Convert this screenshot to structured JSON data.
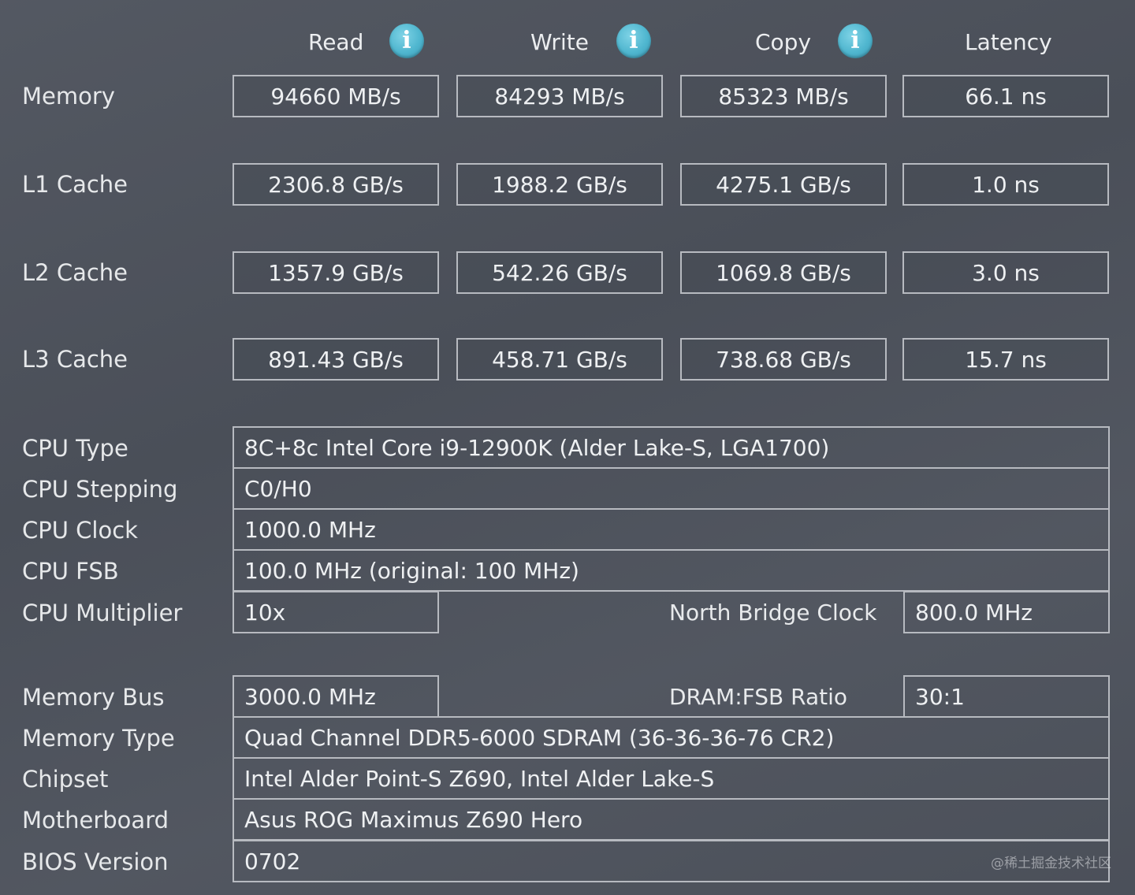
{
  "columns": {
    "read": "Read",
    "write": "Write",
    "copy": "Copy",
    "latency": "Latency",
    "info_icon_glyph": "i"
  },
  "bench": {
    "memory": {
      "label": "Memory",
      "read": "94660 MB/s",
      "write": "84293 MB/s",
      "copy": "85323 MB/s",
      "latency": "66.1 ns"
    },
    "l1": {
      "label": "L1 Cache",
      "read": "2306.8 GB/s",
      "write": "1988.2 GB/s",
      "copy": "4275.1 GB/s",
      "latency": "1.0 ns"
    },
    "l2": {
      "label": "L2 Cache",
      "read": "1357.9 GB/s",
      "write": "542.26 GB/s",
      "copy": "1069.8 GB/s",
      "latency": "3.0 ns"
    },
    "l3": {
      "label": "L3 Cache",
      "read": "891.43 GB/s",
      "write": "458.71 GB/s",
      "copy": "738.68 GB/s",
      "latency": "15.7 ns"
    }
  },
  "cpu": {
    "type_label": "CPU Type",
    "type_value": "8C+8c Intel Core i9-12900K  (Alder Lake-S, LGA1700)",
    "stepping_label": "CPU Stepping",
    "stepping_value": "C0/H0",
    "clock_label": "CPU Clock",
    "clock_value": "1000.0 MHz",
    "fsb_label": "CPU FSB",
    "fsb_value": "100.0 MHz  (original: 100 MHz)",
    "multiplier_label": "CPU Multiplier",
    "multiplier_value": "10x",
    "nb_clock_label": "North Bridge Clock",
    "nb_clock_value": "800.0 MHz"
  },
  "memory": {
    "bus_label": "Memory Bus",
    "bus_value": "3000.0 MHz",
    "ratio_label": "DRAM:FSB Ratio",
    "ratio_value": "30:1",
    "type_label": "Memory Type",
    "type_value": "Quad Channel DDR5-6000 SDRAM  (36-36-36-76 CR2)",
    "chipset_label": "Chipset",
    "chipset_value": "Intel Alder Point-S Z690, Intel Alder Lake-S",
    "motherboard_label": "Motherboard",
    "motherboard_value": "Asus ROG Maximus Z690 Hero",
    "bios_label": "BIOS Version",
    "bios_value": "0702"
  },
  "watermark": "@稀土掘金技术社区",
  "colors": {
    "background": "#4e535d",
    "box_border": "#b7bac0",
    "text": "#e8e9eb",
    "info_icon": "#4fb6cf"
  }
}
